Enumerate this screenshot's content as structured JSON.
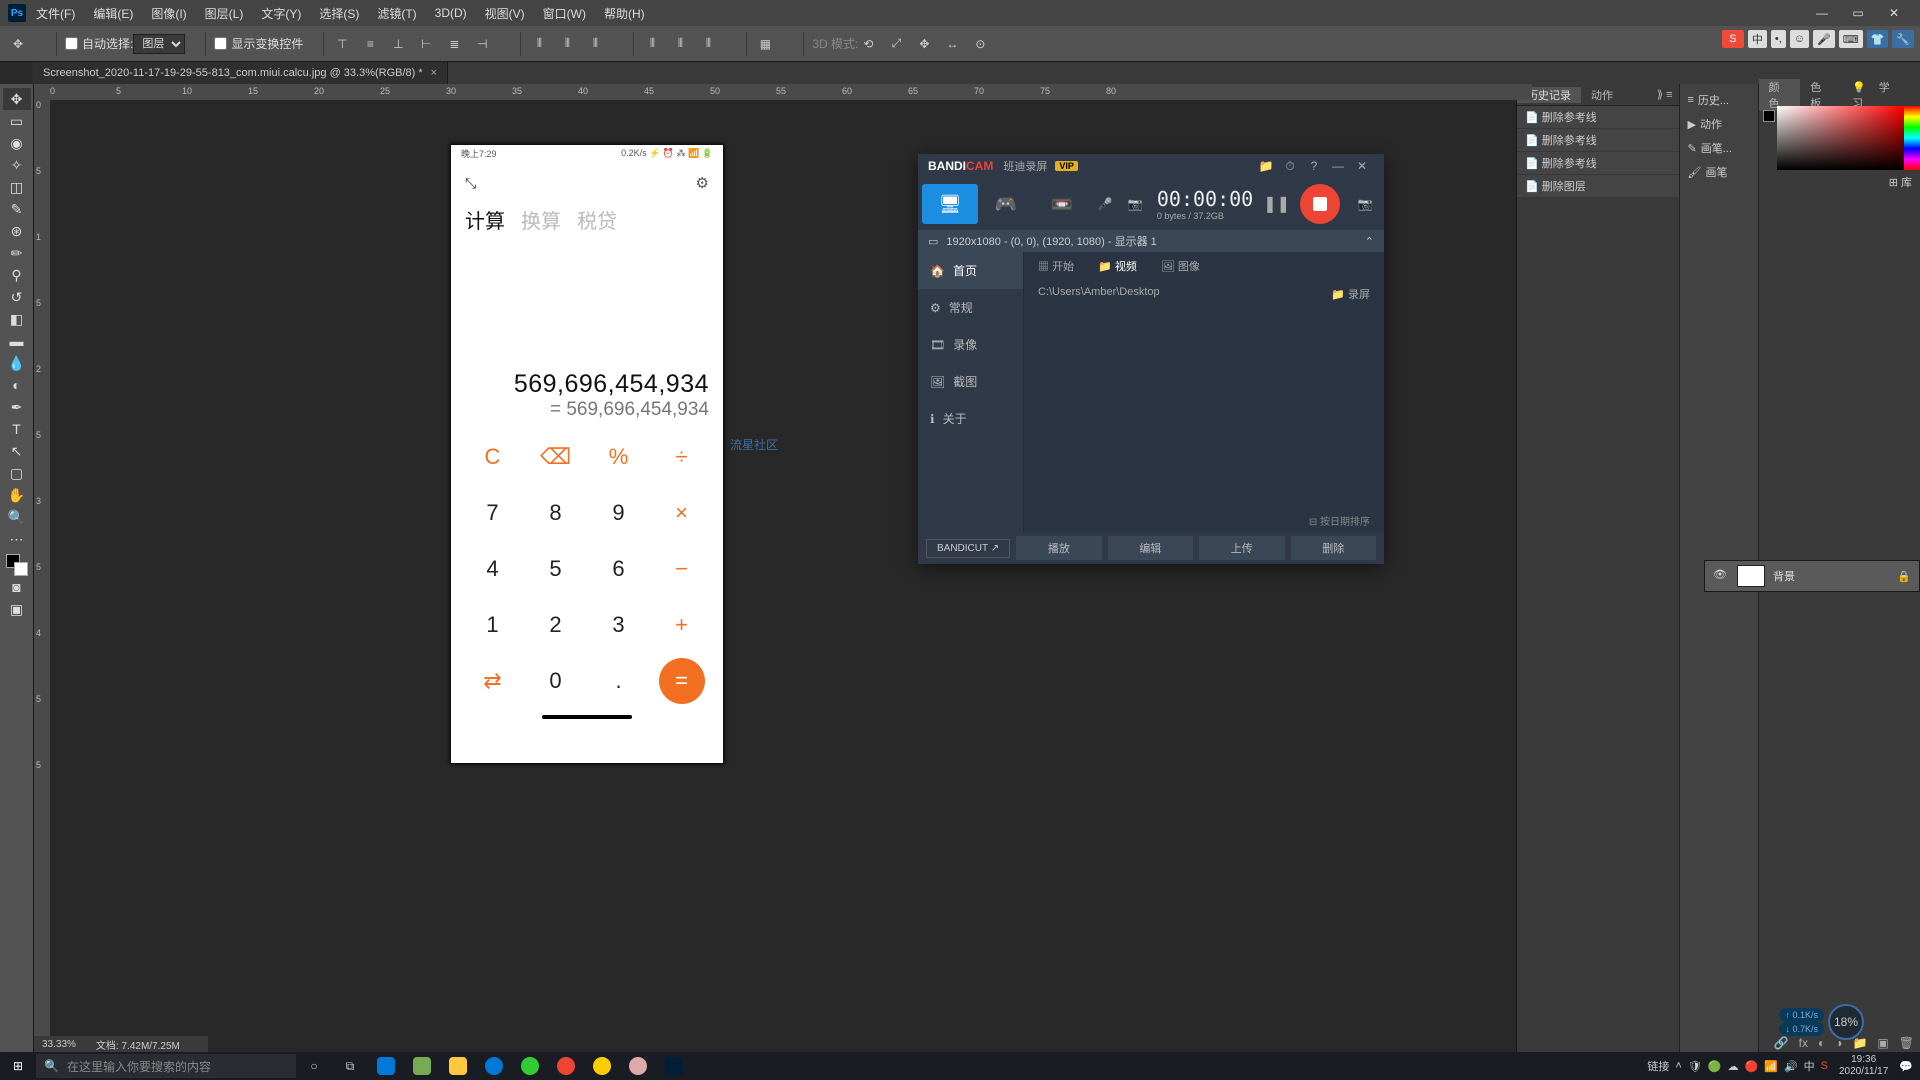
{
  "menubar": {
    "items": [
      "文件(F)",
      "编辑(E)",
      "图像(I)",
      "图层(L)",
      "文字(Y)",
      "选择(S)",
      "滤镜(T)",
      "3D(D)",
      "视图(V)",
      "窗口(W)",
      "帮助(H)"
    ]
  },
  "options": {
    "auto_select_label": "自动选择:",
    "auto_select_value": "图层",
    "transform_controls": "显示变换控件",
    "mode_label": "3D 模式:"
  },
  "tab": {
    "title": "Screenshot_2020-11-17-19-29-55-813_com.miui.calcu.jpg @ 33.3%(RGB/8) *"
  },
  "ruler": {
    "h": [
      "0",
      "5",
      "10",
      "15",
      "20",
      "25",
      "30",
      "35",
      "40",
      "45",
      "50",
      "55",
      "60",
      "65",
      "70",
      "75",
      "80"
    ],
    "v": [
      "0",
      "5",
      "1",
      "5",
      "2",
      "5",
      "3",
      "5",
      "4",
      "5",
      "5"
    ]
  },
  "phone": {
    "status_left": "晚上7:29",
    "status_right": "0.2K/s ⚡ ⏰ ⁂ 📶 🔋",
    "tabs": [
      "计算",
      "换算",
      "税贷"
    ],
    "active_tab": "计算",
    "display_main": "569,696,454,934",
    "display_res": "= 569,696,454,934",
    "keys": [
      {
        "t": "C",
        "cls": "op"
      },
      {
        "t": "⌫",
        "cls": "op"
      },
      {
        "t": "%",
        "cls": "op"
      },
      {
        "t": "÷",
        "cls": "op"
      },
      {
        "t": "7",
        "cls": ""
      },
      {
        "t": "8",
        "cls": ""
      },
      {
        "t": "9",
        "cls": ""
      },
      {
        "t": "×",
        "cls": "op"
      },
      {
        "t": "4",
        "cls": ""
      },
      {
        "t": "5",
        "cls": ""
      },
      {
        "t": "6",
        "cls": ""
      },
      {
        "t": "−",
        "cls": "op"
      },
      {
        "t": "1",
        "cls": ""
      },
      {
        "t": "2",
        "cls": ""
      },
      {
        "t": "3",
        "cls": ""
      },
      {
        "t": "+",
        "cls": "op"
      },
      {
        "t": "⇄",
        "cls": "op"
      },
      {
        "t": "0",
        "cls": ""
      },
      {
        "t": ".",
        "cls": ""
      },
      {
        "t": "=",
        "cls": "eq"
      }
    ]
  },
  "watermark": "流星社区",
  "hist_panel": {
    "tabs": [
      "历史记录",
      "动作"
    ],
    "items": [
      "删除参考线",
      "删除参考线",
      "删除参考线",
      "删除图层"
    ]
  },
  "mini_panel": {
    "items": [
      "历史...",
      "动作",
      "画笔...",
      "画笔"
    ]
  },
  "color_panel": {
    "tabs": [
      "颜色",
      "色板"
    ],
    "study": "学习",
    "lib": "库"
  },
  "layers_panel": {
    "name": "背景"
  },
  "bandicam": {
    "title_main": "BANDI",
    "title_cam": "CAM",
    "subtitle": "班迪录屏",
    "vip": "VIP",
    "time": "00:00:00",
    "size": "0 bytes / 37.2GB",
    "target": "1920x1080 - (0, 0), (1920, 1080) - 显示器 1",
    "sidebar": [
      "首页",
      "常规",
      "录像",
      "截图",
      "关于"
    ],
    "main_tabs": [
      "开始",
      "视频",
      "图像"
    ],
    "path": "C:\\Users\\Amber\\Desktop",
    "folder_lbl": "录屏",
    "sort": "按日期排序",
    "bandicut": "BANDICUT ↗",
    "footer": [
      "播放",
      "编辑",
      "上传",
      "删除"
    ]
  },
  "status_bar": {
    "zoom": "33.33%",
    "doc": "文档: 7.42M/7.25M"
  },
  "taskbar": {
    "search_placeholder": "在这里输入你要搜索的内容",
    "tray_link": "链接",
    "time": "19:36",
    "date": "2020/11/17"
  },
  "right_status": {
    "s": "S",
    "ime": "中",
    "icons": [
      "⚙",
      "☺",
      "🎤",
      "⌨"
    ]
  },
  "netmeter": {
    "up": "↑ 0.1K/s",
    "down": "↓ 0.7K/s",
    "pct": "18%"
  },
  "tool_names": [
    "move",
    "rect-marquee",
    "lasso",
    "magic-wand",
    "crop",
    "eyedropper",
    "spot-heal",
    "brush",
    "clone-stamp",
    "history-brush",
    "eraser",
    "gradient",
    "blur",
    "dodge",
    "pen",
    "type",
    "path-select",
    "rectangle",
    "hand",
    "zoom"
  ]
}
